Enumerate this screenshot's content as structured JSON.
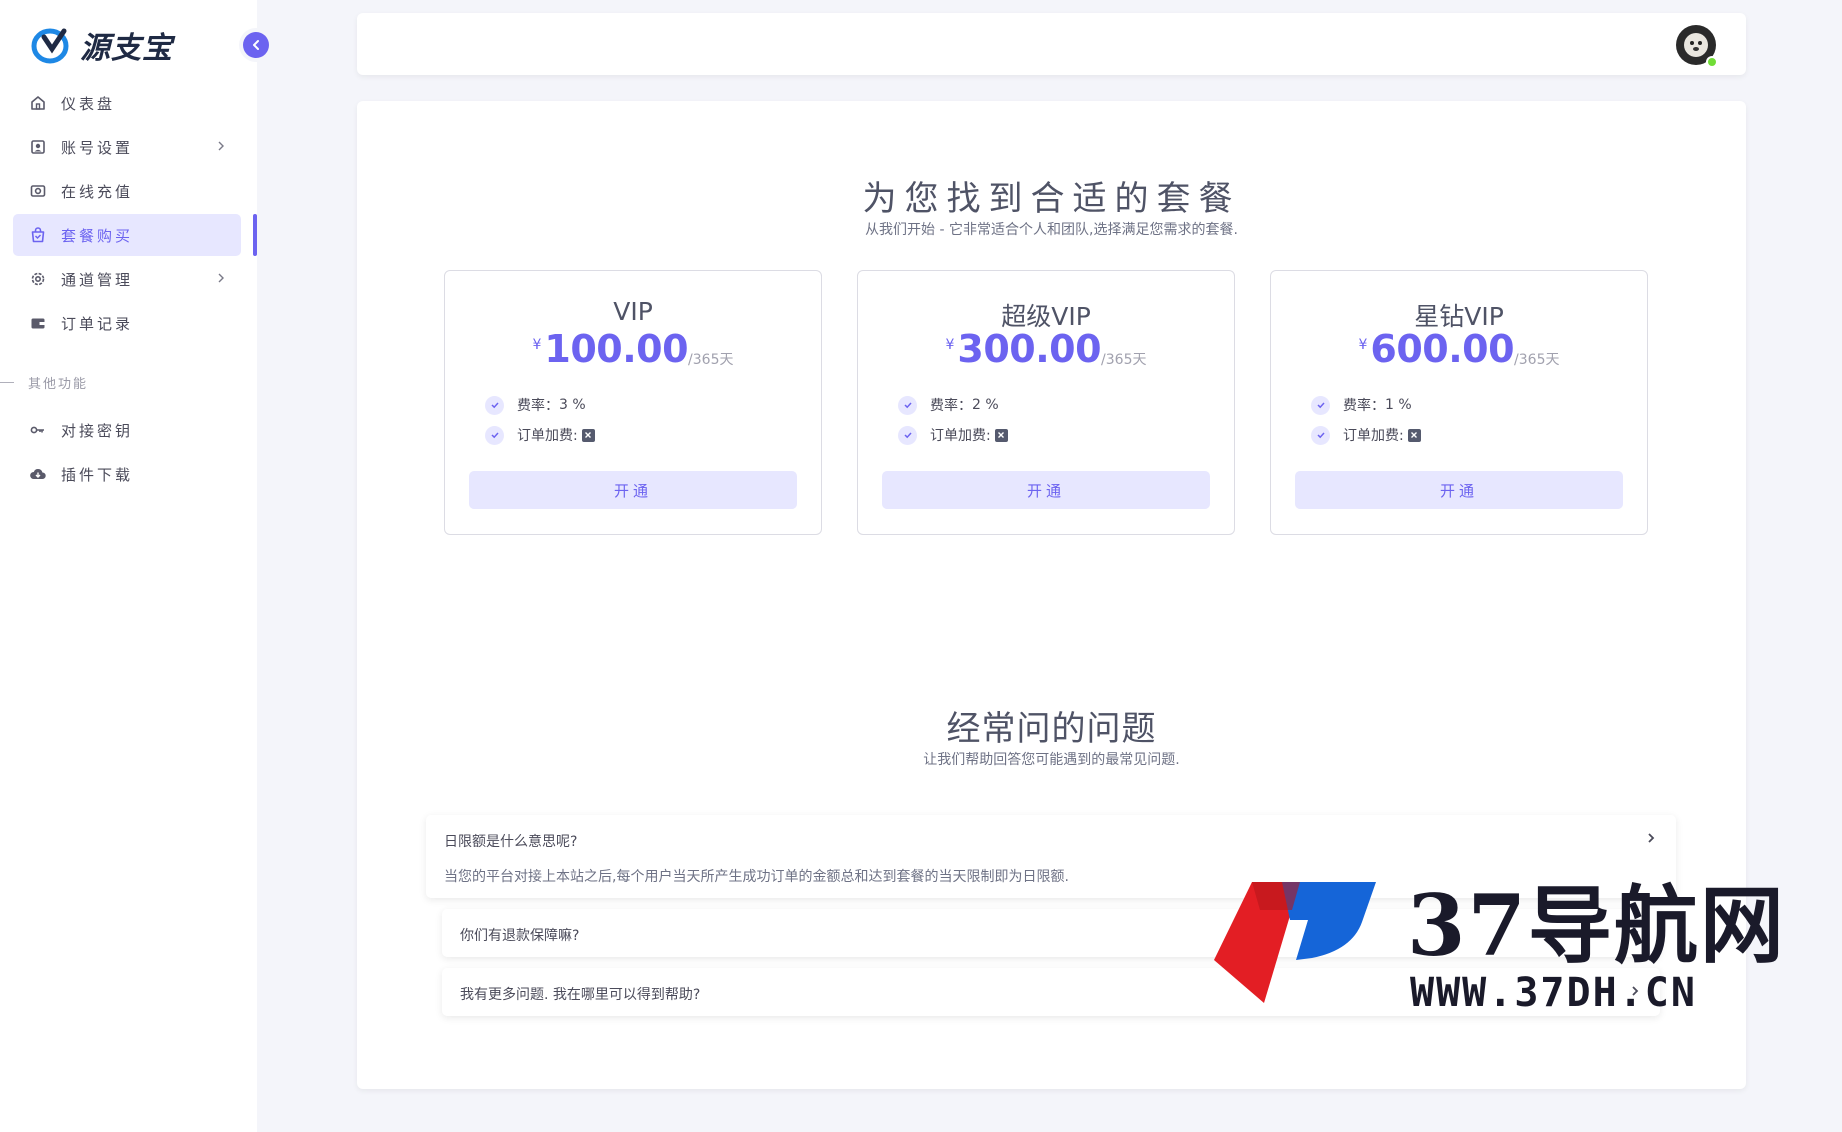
{
  "app": {
    "logo_text": "源支宝"
  },
  "sidebar": {
    "items": [
      {
        "label": "仪表盘",
        "icon": "home-icon",
        "chevron": false,
        "active": false
      },
      {
        "label": "账号设置",
        "icon": "account-icon",
        "chevron": true,
        "active": false
      },
      {
        "label": "在线充值",
        "icon": "recharge-icon",
        "chevron": false,
        "active": false
      },
      {
        "label": "套餐购买",
        "icon": "shopping-bag-icon",
        "chevron": false,
        "active": true
      },
      {
        "label": "通道管理",
        "icon": "gear-icon",
        "chevron": true,
        "active": false
      },
      {
        "label": "订单记录",
        "icon": "wallet-icon",
        "chevron": false,
        "active": false
      }
    ],
    "section_label": "其他功能",
    "items2": [
      {
        "label": "对接密钥",
        "icon": "key-icon"
      },
      {
        "label": "插件下载",
        "icon": "cloud-download-icon"
      }
    ]
  },
  "pricing": {
    "title": "为您找到合适的套餐",
    "subtitle": "从我们开始 - 它非常适合个人和团队,选择满足您需求的套餐.",
    "plans": [
      {
        "name": "VIP",
        "currency": "¥",
        "price": "100.00",
        "period": "/365天",
        "fee_label": "费率：",
        "fee_value": "3 %",
        "order_label": "订单加费:",
        "button": "开通"
      },
      {
        "name": "超级VIP",
        "currency": "¥",
        "price": "300.00",
        "period": "/365天",
        "fee_label": "费率：",
        "fee_value": "2 %",
        "order_label": "订单加费:",
        "button": "开通"
      },
      {
        "name": "星钻VIP",
        "currency": "¥",
        "price": "600.00",
        "period": "/365天",
        "fee_label": "费率：",
        "fee_value": "1 %",
        "order_label": "订单加费:",
        "button": "开通"
      }
    ]
  },
  "faq": {
    "title": "经常问的问题",
    "subtitle": "让我们帮助回答您可能遇到的最常见问题.",
    "items": [
      {
        "question": "日限额是什么意思呢?",
        "answer": "当您的平台对接上本站之后,每个用户当天所产生成功订单的金额总和达到套餐的当天限制即为日限额.",
        "expanded": true
      },
      {
        "question": "你们有退款保障嘛?",
        "answer": "",
        "expanded": false
      },
      {
        "question": "我有更多问题. 我在哪里可以得到帮助?",
        "answer": "",
        "expanded": false
      }
    ]
  },
  "watermark": {
    "text": "37导航网",
    "url": "WWW.37DH.CN"
  },
  "colors": {
    "primary": "#6c63f0",
    "primary_light": "#e7e7ff",
    "online": "#71dd37"
  }
}
